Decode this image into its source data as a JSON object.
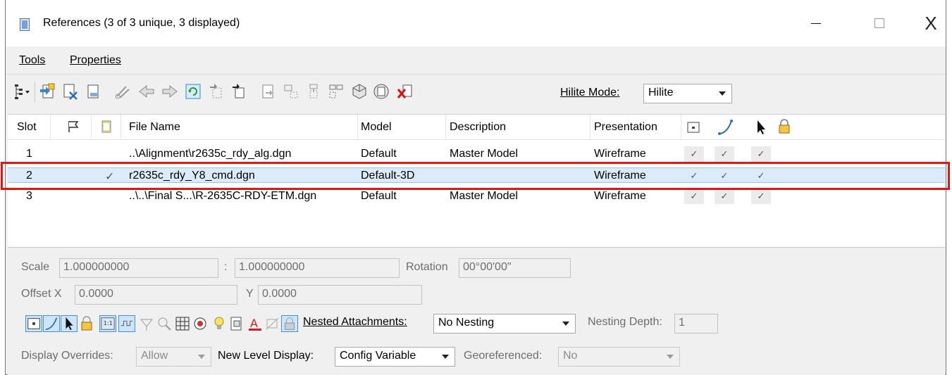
{
  "window": {
    "title": "References (3 of 3 unique, 3 displayed)",
    "controls": {
      "minimize": "–",
      "maximize": "□",
      "close": "X"
    }
  },
  "menu": {
    "tools": "Tools",
    "properties": "Properties"
  },
  "toolbar": {
    "hilite_label": "Hilite Mode:",
    "hilite_value": "Hilite"
  },
  "table": {
    "headers": {
      "slot": "Slot",
      "file_name": "File Name",
      "model": "Model",
      "description": "Description",
      "presentation": "Presentation"
    },
    "rows": [
      {
        "slot": "1",
        "active": "",
        "file_name": "..\\Alignment\\r2635c_rdy_alg.dgn",
        "model": "Default",
        "description": "Master Model",
        "presentation": "Wireframe",
        "display": "✓",
        "snap": "✓",
        "locate": "✓"
      },
      {
        "slot": "2",
        "active": "✓",
        "file_name": "r2635c_rdy_Y8_cmd.dgn",
        "model": "Default-3D",
        "description": "",
        "presentation": "Wireframe",
        "display": "✓",
        "snap": "✓",
        "locate": "✓"
      },
      {
        "slot": "3",
        "active": "",
        "file_name": "..\\..\\Final S...\\R-2635C-RDY-ETM.dgn",
        "model": "Default",
        "description": "Master Model",
        "presentation": "Wireframe",
        "display": "✓",
        "snap": "✓",
        "locate": "✓"
      }
    ],
    "selected_row": 2
  },
  "properties": {
    "scale_label": "Scale",
    "scale_value_1": "1.000000000",
    "scale_sep": ":",
    "scale_value_2": "1.000000000",
    "rotation_label": "Rotation",
    "rotation_value": "00°00'00\"",
    "offset_x_label": "Offset X",
    "offset_x_value": "0.0000",
    "y_label": "Y",
    "y_value": "0.0000",
    "nested_label": "Nested Attachments:",
    "nested_value": "No Nesting",
    "nesting_depth_label": "Nesting Depth:",
    "nesting_depth_value": "1",
    "display_overrides_label": "Display Overrides:",
    "display_overrides_value": "Allow",
    "new_level_label": "New Level Display:",
    "new_level_value": "Config Variable",
    "georeferenced_label": "Georeferenced:",
    "georeferenced_value": "No"
  },
  "colors": {
    "selection_outline": "#e01717",
    "selected_row_bg": "#dcebfc",
    "toggle_on_bg": "#cde4fb"
  }
}
